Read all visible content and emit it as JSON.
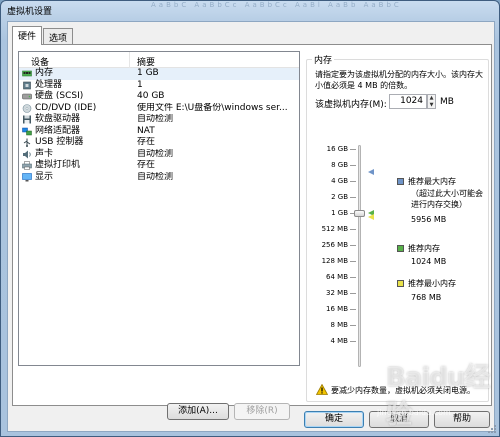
{
  "window": {
    "title": "虚拟机设置",
    "background_title": "AaBbC AaBbCc AaBbCc AaBl AaBb AaBbC"
  },
  "tabs": [
    {
      "label": "硬件",
      "active": true
    },
    {
      "label": "选项",
      "active": false
    }
  ],
  "device_list": {
    "columns": {
      "device": "设备",
      "summary": "摘要"
    },
    "rows": [
      {
        "icon": "memory-icon",
        "name": "内存",
        "summary": "1 GB",
        "selected": true
      },
      {
        "icon": "processor-icon",
        "name": "处理器",
        "summary": "1",
        "selected": false
      },
      {
        "icon": "hard-disk-icon",
        "name": "硬盘 (SCSI)",
        "summary": "40 GB",
        "selected": false
      },
      {
        "icon": "cd-dvd-icon",
        "name": "CD/DVD (IDE)",
        "summary": "使用文件 E:\\U盘备份\\windows ser...",
        "selected": false
      },
      {
        "icon": "floppy-icon",
        "name": "软盘驱动器",
        "summary": "自动检测",
        "selected": false
      },
      {
        "icon": "network-adapter-icon",
        "name": "网络适配器",
        "summary": "NAT",
        "selected": false
      },
      {
        "icon": "usb-icon",
        "name": "USB 控制器",
        "summary": "存在",
        "selected": false
      },
      {
        "icon": "sound-card-icon",
        "name": "声卡",
        "summary": "自动检测",
        "selected": false
      },
      {
        "icon": "printer-icon",
        "name": "虚拟打印机",
        "summary": "存在",
        "selected": false
      },
      {
        "icon": "display-icon",
        "name": "显示",
        "summary": "自动检测",
        "selected": false
      }
    ]
  },
  "list_buttons": {
    "add": "添加(A)...",
    "remove": "移除(R)"
  },
  "memory": {
    "section_title": "内存",
    "description": "请指定要为该虚拟机分配的内存大小。该内存大小值必须是 4 MB 的倍数。",
    "field_label": "该虚拟机内存(M):",
    "value": "1024",
    "unit": "MB",
    "scale_ticks": [
      "16 GB",
      "8 GB",
      "4 GB",
      "2 GB",
      "1 GB",
      "512 MB",
      "256 MB",
      "128 MB",
      "64 MB",
      "32 MB",
      "16 MB",
      "8 MB",
      "4 MB"
    ],
    "current_tick": "1 GB",
    "max_recommended_tick": "8 GB",
    "recommended_tick": "1 GB",
    "legend": [
      {
        "label": "推荐最大内存",
        "note": "（超过此大小可能会进行内存交换）",
        "value": "5956 MB",
        "color": "#6f94c8"
      },
      {
        "label": "推荐内存",
        "value": "1024 MB",
        "color": "#58b14a"
      },
      {
        "label": "推荐最小内存",
        "value": "768 MB",
        "color": "#e9e24a"
      }
    ],
    "warning": "要减少内存数量，虚拟机必须关闭电源。"
  },
  "dialog_buttons": {
    "ok": "确定",
    "cancel": "取消",
    "help": "帮助"
  },
  "watermark": {
    "brand": "Baidu经验",
    "url": "jingyan.baidu.com"
  },
  "colors": {
    "accent": "#3c7fb1",
    "selection": "#e6f0fa",
    "warning": "#f2c400"
  }
}
